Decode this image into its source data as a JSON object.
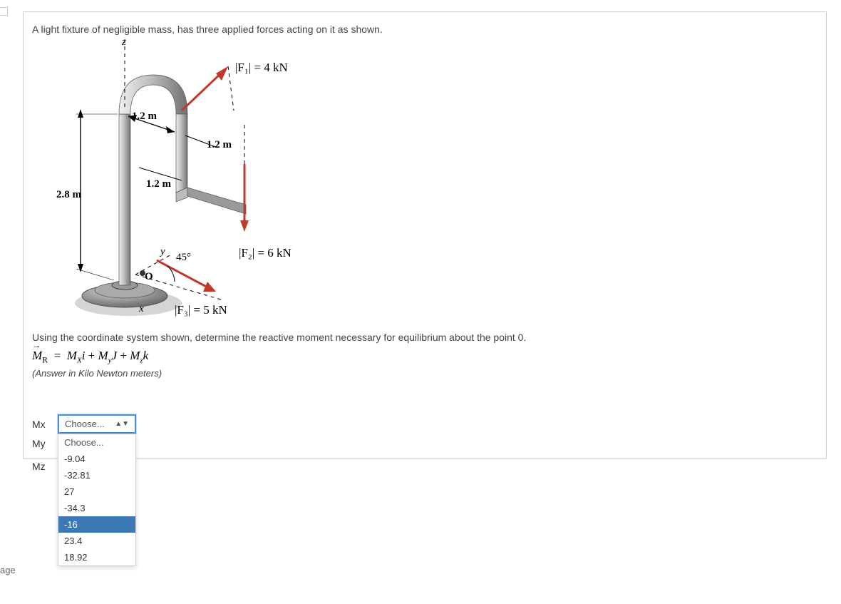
{
  "sidebar": {
    "partial_label": "age"
  },
  "problem": {
    "intro": "A light fixture of negligible mass, has three applied forces acting on it as shown.",
    "instruction": "Using the coordinate system shown, determine the reactive moment necessary for equilibrium about the point 0.",
    "equation_lhs": "M",
    "equation_lhs_sub": "R",
    "equation_rhs_parts": [
      "M",
      "X",
      "i + M",
      "y",
      "J + M",
      "z",
      "k"
    ],
    "answer_note": "(Answer in Kilo Newton meters)"
  },
  "diagram": {
    "axis_z": "z",
    "axis_y": "y",
    "axis_x": "x",
    "origin": "O",
    "dim_height": "2.8 m",
    "dim_arc": "1.2 m",
    "dim_arm1": "1.2 m",
    "dim_arm2": "1.2 m",
    "angle": "45°",
    "f1": "|F₁| = 4 kN",
    "f2": "|F₂| = 6 kN",
    "f3": "|F₃| = 5 kN"
  },
  "answers": {
    "labels": {
      "mx": "Mx",
      "my": "My",
      "mz": "Mz"
    },
    "select_placeholder": "Choose...",
    "dropdown_header": "Choose...",
    "options": [
      "-9.04",
      "-32.81",
      "27",
      "-34.3",
      "-16",
      "23.4",
      "18.92"
    ],
    "highlighted": "-16"
  }
}
